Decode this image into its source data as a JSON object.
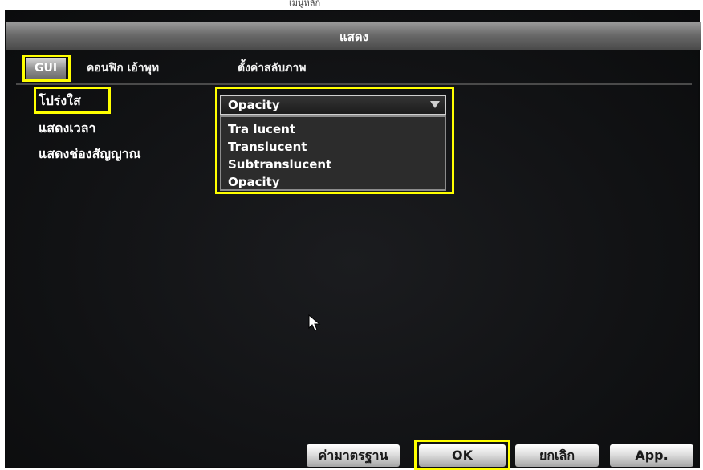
{
  "header": {
    "top_text": "เมนูหลัก",
    "title": "แสดง"
  },
  "tabs": [
    {
      "label": "GUI",
      "active": true
    },
    {
      "label": "คอนฟิก เอ้าพุท",
      "active": false
    },
    {
      "label": "ตั้งค่าสลับภาพ",
      "active": false
    }
  ],
  "settings": {
    "labels": [
      "โปร่งใส",
      "แสดงเวลา",
      "แสดงช่องสัญญาณ"
    ],
    "transparency": {
      "selected": "Opacity",
      "options": [
        "Tra lucent",
        "Translucent",
        "Subtranslucent",
        "Opacity"
      ]
    }
  },
  "buttons": {
    "default": "ค่ามาตรฐาน",
    "ok": "OK",
    "cancel": "ยกเลิก",
    "apply": "App."
  },
  "colors": {
    "highlight": "#ffff00",
    "background": "#131416",
    "text": "#ffffff"
  },
  "icons": {
    "cursor": "mouse-pointer-icon",
    "dropdown": "chevron-down-icon"
  }
}
